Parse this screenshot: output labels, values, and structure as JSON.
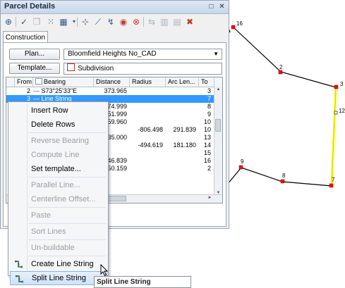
{
  "window": {
    "title": "Parcel Details"
  },
  "tabs": [
    "Construction"
  ],
  "plan": {
    "button_label": "Plan...",
    "value": "Bloomfield Heights No_CAD"
  },
  "template": {
    "button_label": "Template...",
    "value": "Subdivision"
  },
  "grid": {
    "columns": [
      "From",
      "Bearing",
      "Distance",
      "Radius",
      "Arc Len...",
      "To"
    ],
    "rows": [
      {
        "from": "2",
        "bearing": "S73°25'33\"E",
        "distance": "373.965",
        "radius": "",
        "arc": "",
        "to": "3",
        "selected": false
      },
      {
        "from": "3",
        "bearing": "Line String",
        "distance": "",
        "radius": "",
        "arc": "",
        "to": "7",
        "selected": true
      },
      {
        "from": "",
        "bearing": "",
        "distance": "74.999",
        "radius": "",
        "arc": "",
        "to": "8",
        "selected": false
      },
      {
        "from": "",
        "bearing": "",
        "distance": "51.999",
        "radius": "",
        "arc": "",
        "to": "9",
        "selected": false
      },
      {
        "from": "",
        "bearing": "",
        "distance": "59.960",
        "radius": "",
        "arc": "",
        "to": "10",
        "selected": false
      },
      {
        "from": "",
        "bearing": "",
        "distance": "",
        "radius": "-806.498",
        "arc": "291.839",
        "to": "10",
        "selected": false
      },
      {
        "from": "",
        "bearing": "",
        "distance": "35.000",
        "radius": "",
        "arc": "",
        "to": "13",
        "selected": false
      },
      {
        "from": "",
        "bearing": "",
        "distance": "",
        "radius": "-494.619",
        "arc": "181.180",
        "to": "14",
        "selected": false
      },
      {
        "from": "",
        "bearing": "",
        "distance": "",
        "radius": "",
        "arc": "",
        "to": "15",
        "selected": false
      },
      {
        "from": "",
        "bearing": "",
        "distance": "46.839",
        "radius": "",
        "arc": "",
        "to": "16",
        "selected": false
      },
      {
        "from": "",
        "bearing": "",
        "distance": "50.159",
        "radius": "",
        "arc": "",
        "to": "2",
        "selected": false
      }
    ]
  },
  "context_menu": {
    "items": [
      {
        "label": "Insert Row",
        "disabled": false
      },
      {
        "label": "Delete Rows",
        "disabled": false
      },
      {
        "separator": true
      },
      {
        "label": "Reverse Bearing",
        "disabled": true
      },
      {
        "label": "Compute Line",
        "disabled": true
      },
      {
        "label": "Set template...",
        "disabled": false
      },
      {
        "separator": true
      },
      {
        "label": "Parallel Line...",
        "disabled": true
      },
      {
        "label": "Centerline Offset...",
        "disabled": true
      },
      {
        "separator": true
      },
      {
        "label": "Paste",
        "disabled": true
      },
      {
        "separator": true
      },
      {
        "label": "Sort Lines",
        "disabled": true
      },
      {
        "separator": true
      },
      {
        "label": "Un-buildable",
        "disabled": true
      },
      {
        "separator": true
      },
      {
        "label": "Create Line String",
        "disabled": false,
        "icon": "create-line-string-icon"
      },
      {
        "label": "Split Line String",
        "disabled": false,
        "icon": "split-line-string-icon",
        "highlighted": true
      }
    ]
  },
  "tooltip": "Split Line String",
  "map": {
    "points": [
      "16",
      "2",
      "3",
      "12",
      "7",
      "8",
      "9"
    ],
    "colors": {
      "line": "#000000",
      "highlight": "#ffff00",
      "vertex": "#ff0000"
    }
  }
}
